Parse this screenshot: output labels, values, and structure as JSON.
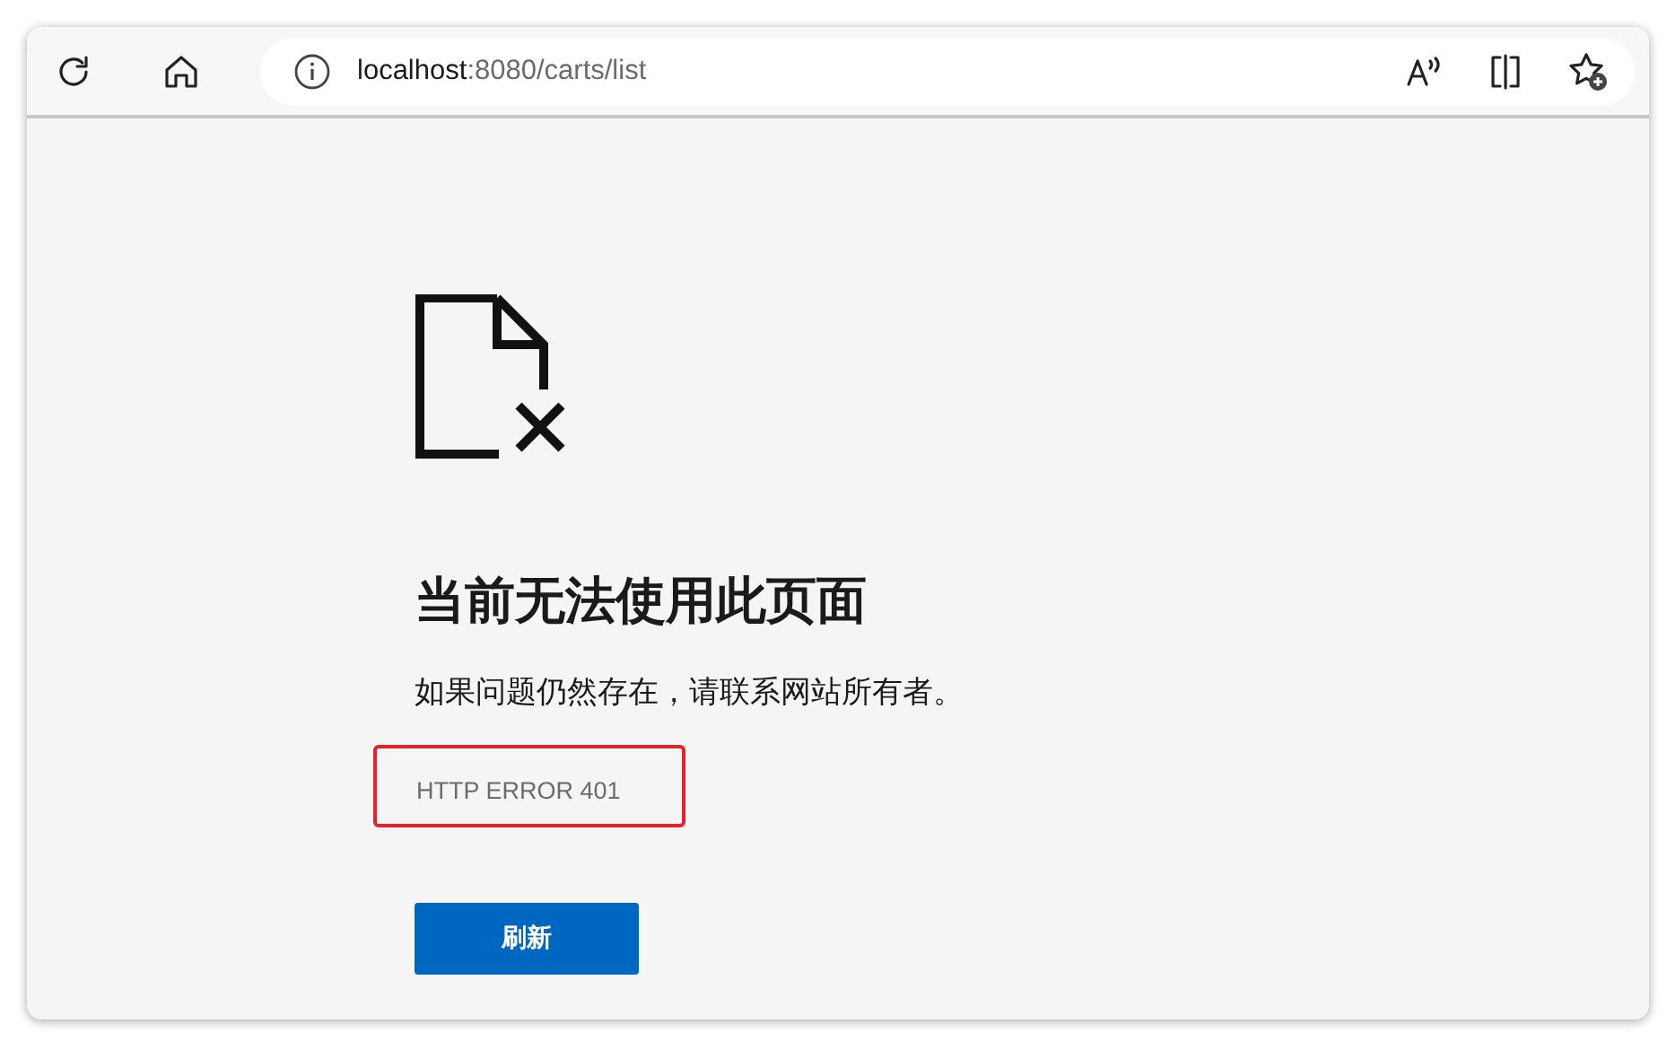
{
  "toolbar": {
    "url_host": "localhost",
    "url_path": ":8080/carts/list"
  },
  "error_page": {
    "heading": "当前无法使用此页面",
    "message": "如果问题仍然存在，请联系网站所有者。",
    "error_code": "HTTP ERROR 401",
    "error_code_highlighted": true,
    "button": "刷新"
  }
}
